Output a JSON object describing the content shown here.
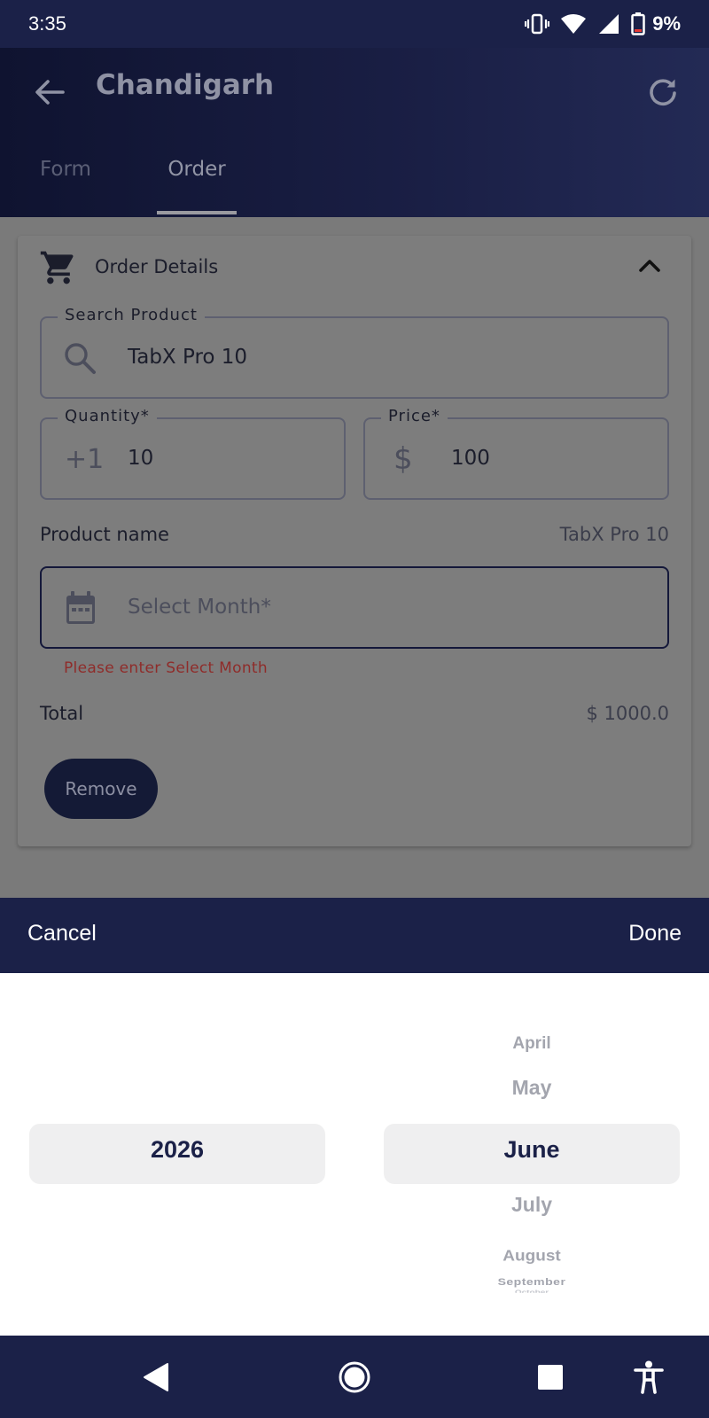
{
  "status_bar": {
    "time": "3:35",
    "battery": "9%",
    "icons": [
      "vibrate-icon",
      "wifi-icon",
      "signal-icon",
      "battery-icon"
    ]
  },
  "app_bar": {
    "title": "Chandigarh",
    "back_icon": "arrow-back-icon",
    "refresh_icon": "refresh-icon",
    "tabs": [
      {
        "label": "Form",
        "selected": false
      },
      {
        "label": "Order",
        "selected": true
      }
    ]
  },
  "order_card": {
    "title": "Order Details",
    "icon": "cart-icon",
    "search_product": {
      "label": "Search Product",
      "value": "TabX Pro 10"
    },
    "quantity": {
      "label": "Quantity*",
      "prefix": "+1",
      "value": "10"
    },
    "price": {
      "label": "Price*",
      "prefix": "$",
      "value": "100"
    },
    "product_name": {
      "label": "Product name",
      "value": "TabX Pro 10"
    },
    "select_month": {
      "placeholder": "Select Month*",
      "error": "Please enter Select Month"
    },
    "total": {
      "label": "Total",
      "value": "$ 1000.0"
    },
    "remove_label": "Remove"
  },
  "picker": {
    "cancel_label": "Cancel",
    "done_label": "Done",
    "year_selected": "2026",
    "months": {
      "april": "April",
      "may": "May",
      "june": "June",
      "july": "July",
      "august": "August",
      "september": "September",
      "october": "October"
    },
    "selected_month": "June"
  },
  "colors": {
    "primary": "#1b2148",
    "error": "#8f2c2a",
    "selection_bg": "#efeff0",
    "picker_dim_text": "#a3a5ae"
  }
}
